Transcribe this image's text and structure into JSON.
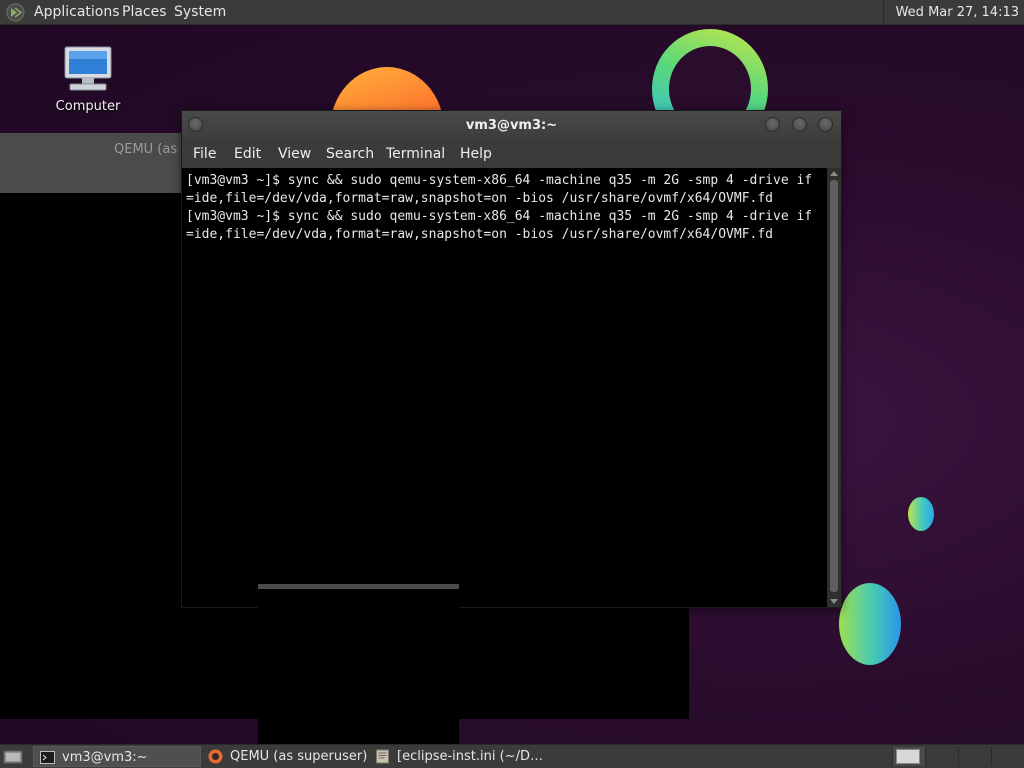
{
  "top_panel": {
    "menus": [
      "Applications",
      "Places",
      "System"
    ],
    "clock": "Wed Mar 27, 14:13"
  },
  "desktop_icons": [
    {
      "label": "Computer",
      "icon": "computer-icon"
    },
    {
      "label": "",
      "icon": "home-folder-icon"
    }
  ],
  "qemu_window": {
    "title": "QEMU (as s"
  },
  "terminal": {
    "title": "vm3@vm3:~",
    "menu": [
      "File",
      "Edit",
      "View",
      "Search",
      "Terminal",
      "Help"
    ],
    "lines": [
      "[vm3@vm3 ~]$ sync && sudo qemu-system-x86_64 -machine q35 -m 2G -smp 4 -drive if",
      "=ide,file=/dev/vda,format=raw,snapshot=on -bios /usr/share/ovmf/x64/OVMF.fd",
      "[vm3@vm3 ~]$ sync && sudo qemu-system-x86_64 -machine q35 -m 2G -smp 4 -drive if",
      "=ide,file=/dev/vda,format=raw,snapshot=on -bios /usr/share/ovmf/x64/OVMF.fd"
    ]
  },
  "taskbar": {
    "tasks": [
      {
        "label": "vm3@vm3:~",
        "icon": "terminal-icon",
        "active": true
      },
      {
        "label": "QEMU (as superuser)",
        "icon": "qemu-icon",
        "active": false
      },
      {
        "label": "[eclipse-inst.ini (~/D…",
        "icon": "text-editor-icon",
        "active": false
      }
    ]
  },
  "colors": {
    "panel": "#3b3b3b",
    "terminal_bg": "#000000",
    "wallpaper": "#2a0c2d"
  }
}
